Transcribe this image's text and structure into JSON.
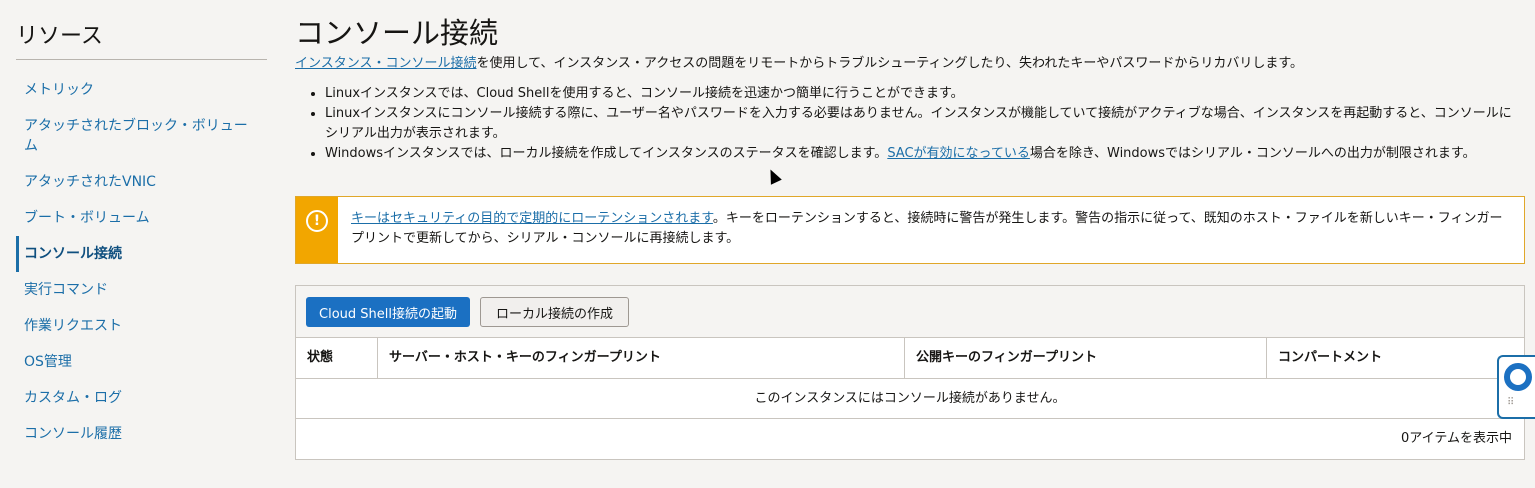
{
  "sidebar": {
    "title": "リソース",
    "items": [
      {
        "label": "メトリック",
        "active": false
      },
      {
        "label": "アタッチされたブロック・ボリューム",
        "active": false
      },
      {
        "label": "アタッチされたVNIC",
        "active": false
      },
      {
        "label": "ブート・ボリューム",
        "active": false
      },
      {
        "label": "コンソール接続",
        "active": true
      },
      {
        "label": "実行コマンド",
        "active": false
      },
      {
        "label": "作業リクエスト",
        "active": false
      },
      {
        "label": "OS管理",
        "active": false
      },
      {
        "label": "カスタム・ログ",
        "active": false
      },
      {
        "label": "コンソール履歴",
        "active": false
      }
    ]
  },
  "main": {
    "title": "コンソール接続",
    "intro": {
      "link": "インスタンス・コンソール接続",
      "text": "を使用して、インスタンス・アクセスの問題をリモートからトラブルシューティングしたり、失われたキーやパスワードからリカバリします。"
    },
    "bullets": {
      "b1": "Linuxインスタンスでは、Cloud Shellを使用すると、コンソール接続を迅速かつ簡単に行うことができます。",
      "b2": "Linuxインスタンスにコンソール接続する際に、ユーザー名やパスワードを入力する必要はありません。インスタンスが機能していて接続がアクティブな場合、インスタンスを再起動すると、コンソールにシリアル出力が表示されます。",
      "b3_pre": "Windowsインスタンスでは、ローカル接続を作成してインスタンスのステータスを確認します。",
      "b3_link": "SACが有効になっている",
      "b3_post": "場合を除き、Windowsではシリアル・コンソールへの出力が制限されます。"
    },
    "warning": {
      "icon": "exclamation-icon",
      "link": "キーはセキュリティの目的で定期的にローテンションされます",
      "text": "。キーをローテンションすると、接続時に警告が発生します。警告の指示に従って、既知のホスト・ファイルを新しいキー・フィンガープリントで更新してから、シリアル・コンソールに再接続します。"
    },
    "toolbar": {
      "primary_label": "Cloud Shell接続の起動",
      "secondary_label": "ローカル接続の作成"
    },
    "table": {
      "columns": [
        "状態",
        "サーバー・ホスト・キーのフィンガープリント",
        "公開キーのフィンガープリント",
        "コンパートメント"
      ],
      "empty_message": "このインスタンスにはコンソール接続がありません。",
      "count_label": "0アイテムを表示中"
    }
  },
  "colors": {
    "link": "#1b6ea8",
    "primary_button": "#1b70c2",
    "warning": "#f2a600",
    "background": "#f5f4f2"
  },
  "help_widget": {
    "icon": "lifebuoy-icon"
  }
}
